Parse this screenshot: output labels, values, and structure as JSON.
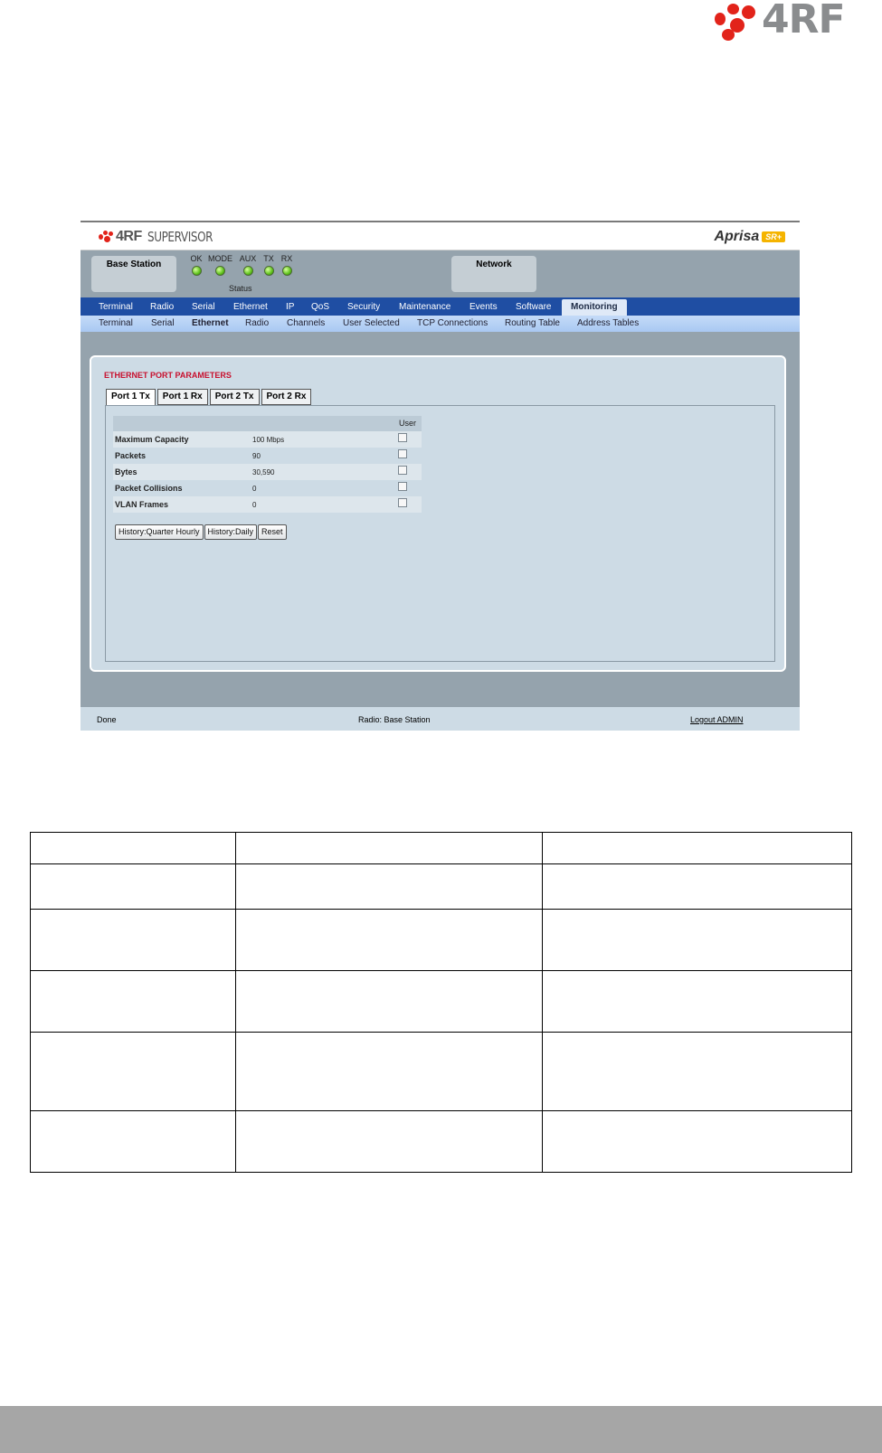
{
  "page_logo": {
    "text": "4RF"
  },
  "window": {
    "title_brand": "4RF",
    "title_product": "SUPERVISOR",
    "product_name": "Aprisa",
    "product_badge": "SR+",
    "station_label": "Base Station",
    "network_label": "Network",
    "leds": [
      "OK",
      "MODE",
      "AUX",
      "TX",
      "RX"
    ],
    "status_caption": "Status",
    "main_menu": [
      "Terminal",
      "Radio",
      "Serial",
      "Ethernet",
      "IP",
      "QoS",
      "Security",
      "Maintenance",
      "Events",
      "Software",
      "Monitoring"
    ],
    "main_menu_active": "Monitoring",
    "sub_menu": [
      "Terminal",
      "Serial",
      "Ethernet",
      "Radio",
      "Channels",
      "User Selected",
      "TCP Connections",
      "Routing Table",
      "Address Tables"
    ],
    "sub_menu_active": "Ethernet",
    "panel_title": "ETHERNET PORT PARAMETERS",
    "tabs": [
      "Port 1 Tx",
      "Port 1 Rx",
      "Port 2 Tx",
      "Port 2 Rx"
    ],
    "tab_active": "Port 1 Tx",
    "user_column": "User",
    "rows": [
      {
        "label": "Maximum Capacity",
        "value": "100 Mbps"
      },
      {
        "label": "Packets",
        "value": "90"
      },
      {
        "label": "Bytes",
        "value": "30,590"
      },
      {
        "label": "Packet Collisions",
        "value": "0"
      },
      {
        "label": "VLAN Frames",
        "value": "0"
      }
    ],
    "buttons": [
      "History:Quarter Hourly",
      "History:Daily",
      "Reset"
    ],
    "statusbar": {
      "left": "Done",
      "center": "Radio: Base Station",
      "right": "Logout ADMIN"
    }
  },
  "doc_table": {
    "rows": 6,
    "columns": 3
  }
}
